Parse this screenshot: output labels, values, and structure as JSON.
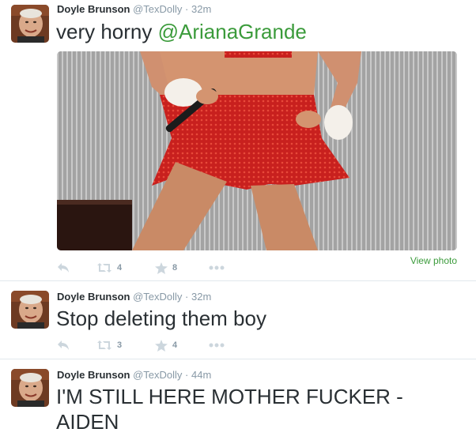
{
  "tweets": [
    {
      "author": "Doyle Brunson",
      "handle": "@TexDolly",
      "separator": "·",
      "time": "32m",
      "text_plain": "very horny ",
      "mention": "@ArianaGrande",
      "has_photo": true,
      "view_photo_label": "View photo",
      "retweets": "4",
      "favorites": "8"
    },
    {
      "author": "Doyle Brunson",
      "handle": "@TexDolly",
      "separator": "·",
      "time": "32m",
      "text": "Stop deleting them boy",
      "retweets": "3",
      "favorites": "4"
    },
    {
      "author": "Doyle Brunson",
      "handle": "@TexDolly",
      "separator": "·",
      "time": "44m",
      "text": "I'M STILL HERE MOTHER FUCKER - AIDEN"
    }
  ],
  "icons": {
    "reply": "reply-icon",
    "retweet": "retweet-icon",
    "favorite": "star-icon",
    "more": "more-dots-icon"
  },
  "colors": {
    "link": "#3b9b3b",
    "muted": "#8899a6",
    "text": "#292f33",
    "icon": "#ccd6dd"
  }
}
